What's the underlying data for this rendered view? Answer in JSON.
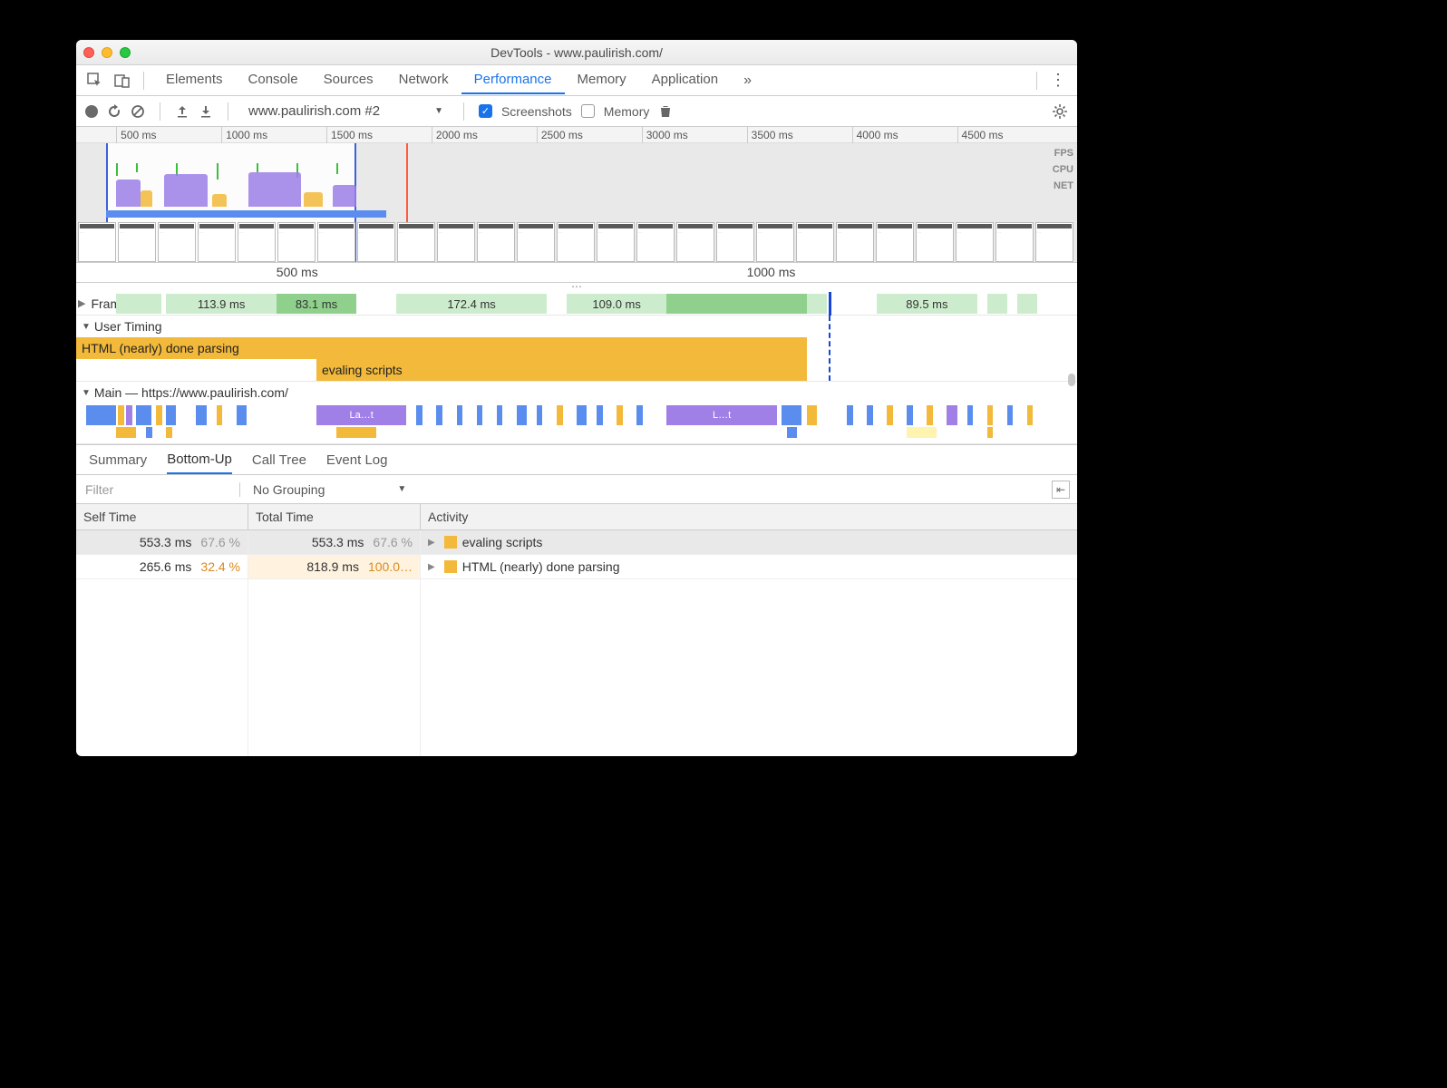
{
  "window": {
    "title": "DevTools - www.paulirish.com/"
  },
  "panel_tabs": {
    "items": [
      "Elements",
      "Console",
      "Sources",
      "Network",
      "Performance",
      "Memory",
      "Application"
    ],
    "active": "Performance",
    "overflow": "»"
  },
  "toolbar": {
    "recording_select": "www.paulirish.com #2",
    "screenshots_label": "Screenshots",
    "screenshots_checked": true,
    "memory_label": "Memory",
    "memory_checked": false
  },
  "overview": {
    "ticks": [
      "500 ms",
      "1000 ms",
      "1500 ms",
      "2000 ms",
      "2500 ms",
      "3000 ms",
      "3500 ms",
      "4000 ms",
      "4500 ms"
    ],
    "lane_labels": [
      "FPS",
      "CPU",
      "NET"
    ],
    "selection_pct": {
      "start": 3,
      "end": 28
    },
    "red_marker_pct": 33
  },
  "detail_ruler": {
    "ticks": [
      {
        "label": "500 ms",
        "pct": 20
      },
      {
        "label": "1000 ms",
        "pct": 67
      }
    ]
  },
  "frames": {
    "label": "Frames",
    "segments": [
      {
        "label": "",
        "start": 4,
        "width": 4.5
      },
      {
        "label": "113.9 ms",
        "start": 9,
        "width": 11
      },
      {
        "label": "83.1 ms",
        "start": 20,
        "width": 8,
        "selected": true
      },
      {
        "label": "172.4 ms",
        "start": 32,
        "width": 15
      },
      {
        "label": "109.0 ms",
        "start": 49,
        "width": 10
      },
      {
        "label": "",
        "start": 59,
        "width": 14,
        "selected": true
      },
      {
        "label": "",
        "start": 73,
        "width": 2
      },
      {
        "label": "89.5 ms",
        "start": 80,
        "width": 10
      },
      {
        "label": "",
        "start": 91,
        "width": 2
      },
      {
        "label": "",
        "start": 94,
        "width": 2
      }
    ]
  },
  "user_timing": {
    "label": "User Timing",
    "bars": [
      {
        "label": "HTML (nearly) done parsing",
        "start": 0,
        "width": 73
      },
      {
        "label": "evaling scripts",
        "start": 24,
        "width": 49
      }
    ]
  },
  "main": {
    "label": "Main — https://www.paulirish.com/",
    "chips_row1": [
      {
        "c": "#5b8def",
        "s": 1,
        "w": 3
      },
      {
        "c": "#f2b93b",
        "s": 4.2,
        "w": 0.6
      },
      {
        "c": "#a07fe6",
        "s": 5,
        "w": 0.6
      },
      {
        "c": "#5b8def",
        "s": 6,
        "w": 1.5
      },
      {
        "c": "#f2b93b",
        "s": 8,
        "w": 0.6
      },
      {
        "c": "#5b8def",
        "s": 9,
        "w": 1
      },
      {
        "c": "#5b8def",
        "s": 12,
        "w": 1
      },
      {
        "c": "#f2b93b",
        "s": 14,
        "w": 0.6
      },
      {
        "c": "#5b8def",
        "s": 16,
        "w": 1
      },
      {
        "c": "#a07fe6",
        "s": 24,
        "w": 9,
        "label": "La…t"
      },
      {
        "c": "#5b8def",
        "s": 34,
        "w": 0.6
      },
      {
        "c": "#5b8def",
        "s": 36,
        "w": 0.6
      },
      {
        "c": "#5b8def",
        "s": 38,
        "w": 0.6
      },
      {
        "c": "#5b8def",
        "s": 40,
        "w": 0.6
      },
      {
        "c": "#5b8def",
        "s": 42,
        "w": 0.6
      },
      {
        "c": "#5b8def",
        "s": 44,
        "w": 1
      },
      {
        "c": "#5b8def",
        "s": 46,
        "w": 0.6
      },
      {
        "c": "#f2b93b",
        "s": 48,
        "w": 0.6
      },
      {
        "c": "#5b8def",
        "s": 50,
        "w": 1
      },
      {
        "c": "#5b8def",
        "s": 52,
        "w": 0.6
      },
      {
        "c": "#f2b93b",
        "s": 54,
        "w": 0.6
      },
      {
        "c": "#5b8def",
        "s": 56,
        "w": 0.6
      },
      {
        "c": "#a07fe6",
        "s": 59,
        "w": 11,
        "label": "L…t"
      },
      {
        "c": "#5b8def",
        "s": 70.5,
        "w": 2
      },
      {
        "c": "#f2b93b",
        "s": 73,
        "w": 1
      },
      {
        "c": "#5b8def",
        "s": 77,
        "w": 0.6
      },
      {
        "c": "#5b8def",
        "s": 79,
        "w": 0.6
      },
      {
        "c": "#f2b93b",
        "s": 81,
        "w": 0.6
      },
      {
        "c": "#5b8def",
        "s": 83,
        "w": 0.6
      },
      {
        "c": "#f2b93b",
        "s": 85,
        "w": 0.6
      },
      {
        "c": "#a07fe6",
        "s": 87,
        "w": 1
      },
      {
        "c": "#5b8def",
        "s": 89,
        "w": 0.6
      },
      {
        "c": "#f2b93b",
        "s": 91,
        "w": 0.6
      },
      {
        "c": "#5b8def",
        "s": 93,
        "w": 0.6
      },
      {
        "c": "#f2b93b",
        "s": 95,
        "w": 0.6
      }
    ],
    "chips_row2": [
      {
        "c": "#f2b93b",
        "s": 4,
        "w": 2
      },
      {
        "c": "#5b8def",
        "s": 7,
        "w": 0.6
      },
      {
        "c": "#f2b93b",
        "s": 9,
        "w": 0.6
      },
      {
        "c": "#f2b93b",
        "s": 26,
        "w": 4
      },
      {
        "c": "#5b8def",
        "s": 71,
        "w": 1
      },
      {
        "c": "#fff3b0",
        "s": 83,
        "w": 3
      },
      {
        "c": "#f2b93b",
        "s": 91,
        "w": 0.6
      }
    ]
  },
  "bottom_tabs": {
    "items": [
      "Summary",
      "Bottom-Up",
      "Call Tree",
      "Event Log"
    ],
    "active": "Bottom-Up"
  },
  "filter": {
    "placeholder": "Filter",
    "grouping": "No Grouping"
  },
  "table": {
    "headers": [
      "Self Time",
      "Total Time",
      "Activity"
    ],
    "rows": [
      {
        "self": "553.3 ms",
        "self_pct": "67.6 %",
        "total": "553.3 ms",
        "total_pct": "67.6 %",
        "activity": "evaling scripts",
        "selected": true
      },
      {
        "self": "265.6 ms",
        "self_pct": "32.4 %",
        "total": "818.9 ms",
        "total_pct": "100.0…",
        "activity": "HTML (nearly) done parsing",
        "shade": true
      }
    ]
  }
}
